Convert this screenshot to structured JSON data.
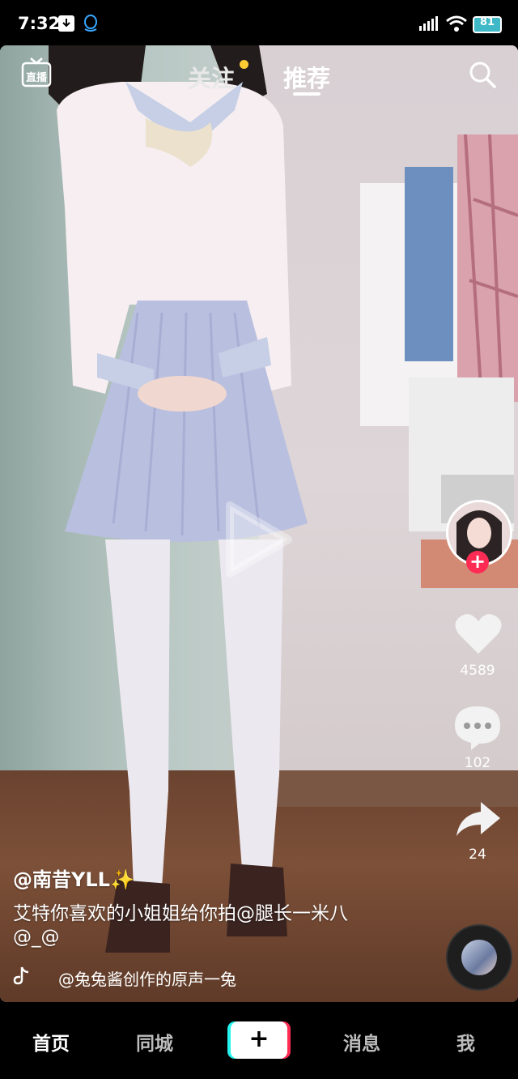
{
  "status_bar": {
    "time": "7:32",
    "battery": "81",
    "icons": [
      "download-icon",
      "qq-icon",
      "signal-icon",
      "wifi-icon",
      "battery-icon"
    ]
  },
  "top_nav": {
    "live_label": "直播",
    "tabs": [
      {
        "label": "关注",
        "has_dot": true,
        "active": false
      },
      {
        "label": "推荐",
        "active": true
      }
    ],
    "accent_color": "#ffcc33"
  },
  "actions": {
    "likes": "4589",
    "comments": "102",
    "shares": "24"
  },
  "post": {
    "author": "@南昔YLL",
    "author_emoji": "✨",
    "description": "艾特你喜欢的小姐姐给你拍@腿长一米八",
    "mention": "@_@",
    "music": "@兔兔酱创作的原声一兔"
  },
  "bottom_nav": {
    "items": [
      "首页",
      "同城",
      "消息",
      "我"
    ],
    "plus": "+",
    "active": "首页"
  },
  "colors": {
    "follow_plus": "#fe2c55",
    "tab_active": "#ffffff",
    "tab_inactive": "#e8e8e8"
  }
}
